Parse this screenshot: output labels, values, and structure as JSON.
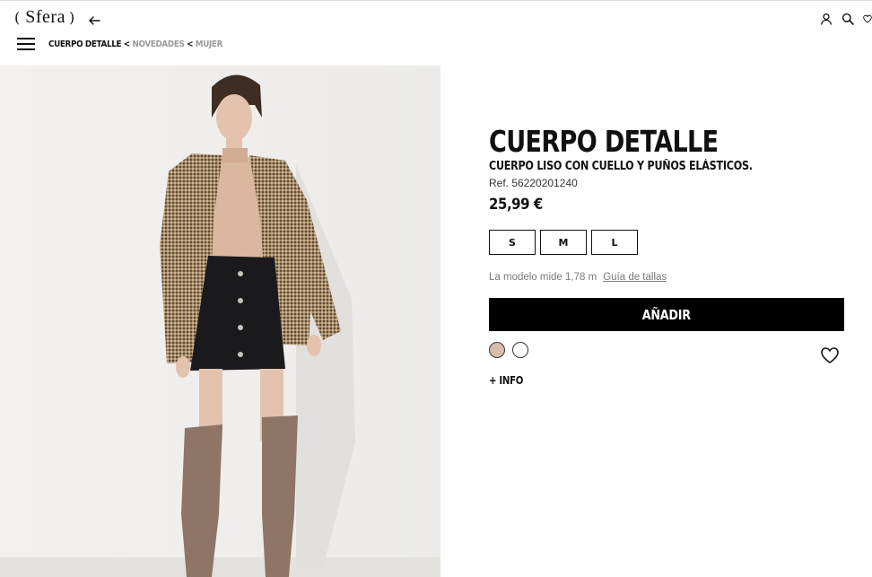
{
  "header": {
    "logo_text": "Sfera",
    "breadcrumb": {
      "current": "CUERPO DETALLE",
      "separator": "<",
      "items": [
        "NOVEDADES",
        "MUJER"
      ]
    },
    "icons": [
      "user-icon",
      "search-icon",
      "wishlist-icon"
    ]
  },
  "product": {
    "title": "CUERPO DETALLE",
    "subtitle": "CUERPO LISO CON CUELLO Y PUÑOS ELÁSTICOS.",
    "ref": "Ref. 56220201240",
    "price": "25,99 €",
    "sizes": [
      "S",
      "M",
      "L"
    ],
    "model_note": "La modelo mide 1,78 m",
    "size_guide": "Guía de tallas",
    "add_button": "AÑADIR",
    "info_link": "+ INFO",
    "colors": [
      {
        "name": "beige",
        "hex": "#d8bcaa"
      },
      {
        "name": "white",
        "hex": "#ffffff"
      }
    ]
  },
  "colors": {
    "text": "#111111",
    "muted": "#9a9a9a",
    "button_bg": "#000000",
    "button_text": "#ffffff"
  }
}
